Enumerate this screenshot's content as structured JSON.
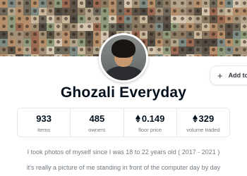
{
  "collection": {
    "name": "Ghozali Everyday"
  },
  "actions": {
    "add_label": "Add to"
  },
  "stats": [
    {
      "value": "933",
      "label": "items",
      "currency": null
    },
    {
      "value": "485",
      "label": "owners",
      "currency": null
    },
    {
      "value": "0.149",
      "label": "floor price",
      "currency": "eth-icon"
    },
    {
      "value": "329",
      "label": "volume traded",
      "currency": "eth-icon"
    }
  ],
  "description": {
    "line1": "I took photos of myself since I was 18 to 22 years old ( 2017 - 2021 )",
    "line2": "it's really a picture of me standing in front of the computer day by day"
  },
  "colors": {
    "text_primary": "#04111d",
    "text_secondary": "#707a83",
    "border": "#e5e8eb"
  }
}
